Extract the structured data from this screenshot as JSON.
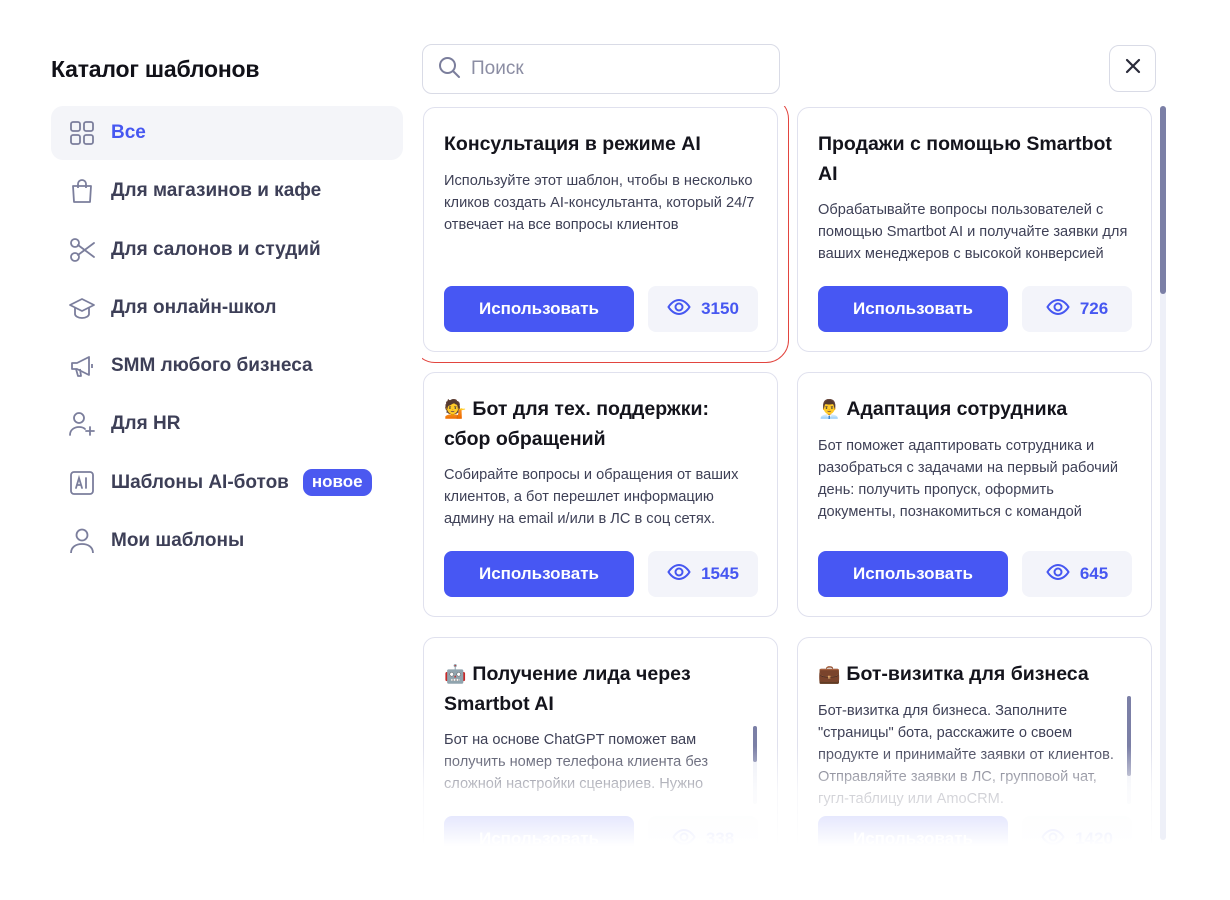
{
  "header": {
    "title": "Каталог шаблонов"
  },
  "search": {
    "placeholder": "Поиск"
  },
  "sidebar": {
    "items": [
      {
        "label": "Все",
        "icon": "grid-icon",
        "active": true
      },
      {
        "label": "Для магазинов и кафе",
        "icon": "shopping-bag-icon"
      },
      {
        "label": "Для салонов и студий",
        "icon": "scissors-icon"
      },
      {
        "label": "Для онлайн-школ",
        "icon": "graduation-cap-icon"
      },
      {
        "label": "SMM любого бизнеса",
        "icon": "megaphone-icon"
      },
      {
        "label": "Для HR",
        "icon": "user-plus-icon"
      },
      {
        "label": "Шаблоны AI-ботов",
        "icon": "ai-icon",
        "badge": "новое"
      },
      {
        "label": "Мои шаблоны",
        "icon": "user-icon"
      }
    ]
  },
  "cards": [
    {
      "emoji": "",
      "title": "Консультация в режиме AI",
      "desc": "Используйте этот шаблон, чтобы в несколько кликов создать AI-консультанта, который 24/7 отвечает на все вопросы клиентов",
      "button": "Использовать",
      "views": "3150"
    },
    {
      "emoji": "",
      "title": "Продажи с помощью Smartbot AI",
      "desc": "Обрабатывайте вопросы пользователей с помощью Smartbot AI и получайте заявки для ваших менеджеров с высокой конверсией",
      "button": "Использовать",
      "views": "726"
    },
    {
      "emoji": "💁",
      "title": "Бот для тех. поддержки: сбор обращений",
      "desc": "Собирайте вопросы и обращения от ваших клиентов, а бот перешлет информацию админу на email и/или в ЛС в соц сетях.",
      "button": "Использовать",
      "views": "1545"
    },
    {
      "emoji": "👨‍💼",
      "title": "Адаптация сотрудника",
      "desc": "Бот поможет адаптировать сотрудника и разобраться с задачами на первый рабочий день: получить пропуск, оформить документы, познакомиться с командой",
      "button": "Использовать",
      "views": "645"
    },
    {
      "emoji": "🤖",
      "title": "Получение лида через Smartbot AI",
      "desc": "Бот на основе ChatGPT поможет вам получить номер телефона клиента без сложной настройки сценариев. Нужно только заполнить информацию о своей",
      "button": "Использовать",
      "views": "338"
    },
    {
      "emoji": "💼",
      "title": "Бот-визитка для бизнеса",
      "desc": "Бот-визитка для бизнеса. Заполните \"страницы\" бота, расскажите о своем продукте и принимайте заявки от клиентов. Отправляйте заявки в ЛС, групповой чат, гугл-таблицу или AmoCRM.",
      "button": "Использовать",
      "views": "1420"
    }
  ],
  "colors": {
    "accent": "#4757f3",
    "selected_outline": "#e2453f",
    "text_muted": "#3e4056"
  }
}
